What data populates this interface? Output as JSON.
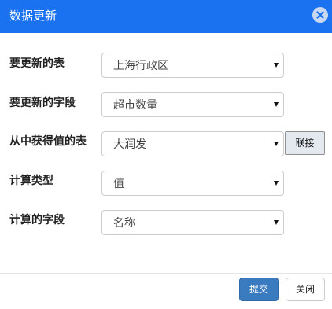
{
  "dialog": {
    "title": "数据更新",
    "close_icon": "close-circle-icon"
  },
  "form": {
    "fields": [
      {
        "label": "要更新的表",
        "value": "上海行政区"
      },
      {
        "label": "要更新的字段",
        "value": "超市数量"
      },
      {
        "label": "从中获得值的表",
        "value": "大润发",
        "action_label": "联接"
      },
      {
        "label": "计算类型",
        "value": "值"
      },
      {
        "label": "计算的字段",
        "value": "名称"
      }
    ]
  },
  "footer": {
    "submit_label": "提交",
    "close_label": "关闭"
  },
  "colors": {
    "titlebar": "#1a72f0",
    "primary_button": "#3a7bc0"
  }
}
